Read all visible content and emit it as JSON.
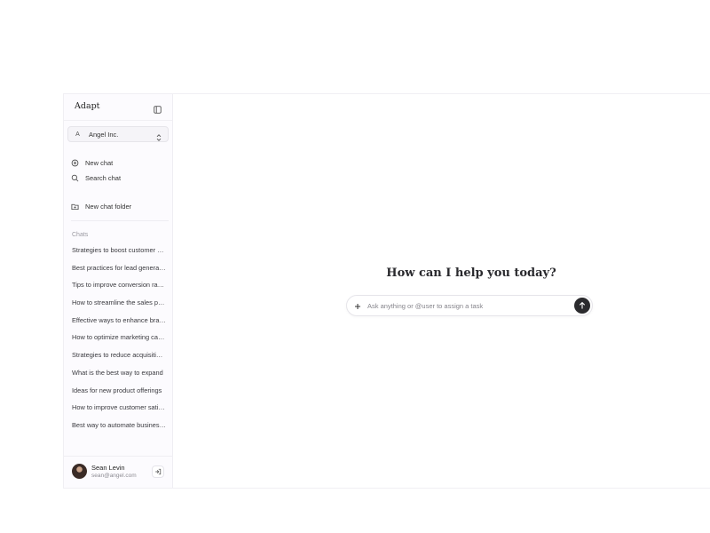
{
  "sidebar": {
    "brand": "Adapt",
    "org": {
      "avatar_letter": "A",
      "name": "Angel Inc."
    },
    "nav": {
      "new_chat": "New chat",
      "search_chat": "Search chat",
      "new_folder": "New chat folder"
    },
    "chats_label": "Chats",
    "chats": [
      "Strategies to boost customer engagement",
      "Best practices for lead generation",
      "Tips to improve conversion rates",
      "How to streamline the sales process",
      "Effective ways to enhance brand awareness",
      "How to optimize marketing campaigns",
      "Strategies to reduce acquisition costs",
      "What is the best way to expand",
      "Ideas for new product offerings",
      "How to improve customer satisfaction",
      "Best way to automate business processes"
    ],
    "user": {
      "name": "Sean Levin",
      "email": "sean@angel.com"
    }
  },
  "main": {
    "greeting": "How can I help you today?",
    "composer": {
      "placeholder": "Ask anything or @user to assign a task"
    }
  },
  "colors": {
    "send_button": "#2b2b2e",
    "sidebar_bg": "#fcfbfe"
  }
}
